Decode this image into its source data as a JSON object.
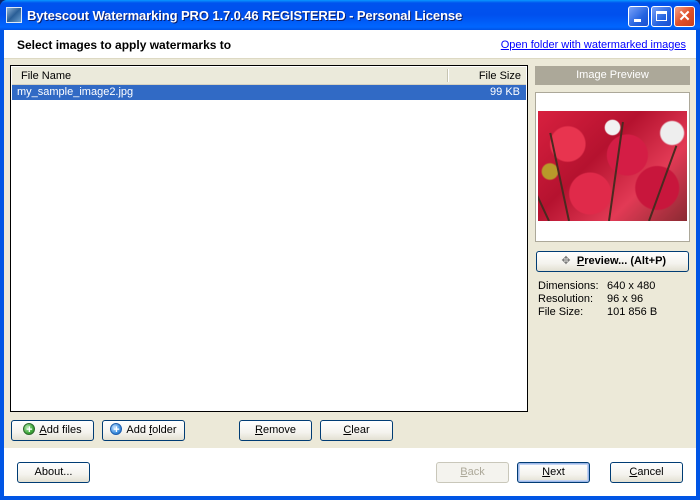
{
  "window": {
    "title": "Bytescout Watermarking PRO 1.7.0.46 REGISTERED - Personal License",
    "controls": {
      "minimize": "minimize",
      "maximize": "maximize",
      "close": "✕"
    }
  },
  "header": {
    "title": "Select images to apply watermarks to",
    "link": "Open folder with watermarked images"
  },
  "filelist": {
    "columns": {
      "name": "File Name",
      "size": "File Size"
    },
    "rows": [
      {
        "name": "my_sample_image2.jpg",
        "size": "99 KB",
        "selected": true
      }
    ]
  },
  "preview": {
    "label": "Image Preview",
    "button_prefix": "P",
    "button_rest": "review... (Alt+P)",
    "info": [
      {
        "label": "Dimensions:",
        "value": "640 x 480"
      },
      {
        "label": "Resolution:",
        "value": "96 x 96"
      },
      {
        "label": "File Size:",
        "value": "101 856 B"
      }
    ]
  },
  "actions": {
    "add_files": {
      "accel": "A",
      "rest": "dd files"
    },
    "add_folder": {
      "pre": "Add ",
      "accel": "f",
      "rest": "older"
    },
    "remove": {
      "accel": "R",
      "rest": "emove"
    },
    "clear": {
      "accel": "C",
      "rest": "lear"
    }
  },
  "footer": {
    "about": "About...",
    "back": {
      "accel": "B",
      "rest": "ack",
      "disabled": true
    },
    "next": {
      "accel": "N",
      "rest": "ext"
    },
    "cancel": {
      "accel": "C",
      "rest": "ancel"
    }
  },
  "colors": {
    "titlebar": "#0054e3",
    "selection": "#316ac5",
    "link": "#0000ff",
    "panel": "#ece9d8"
  }
}
